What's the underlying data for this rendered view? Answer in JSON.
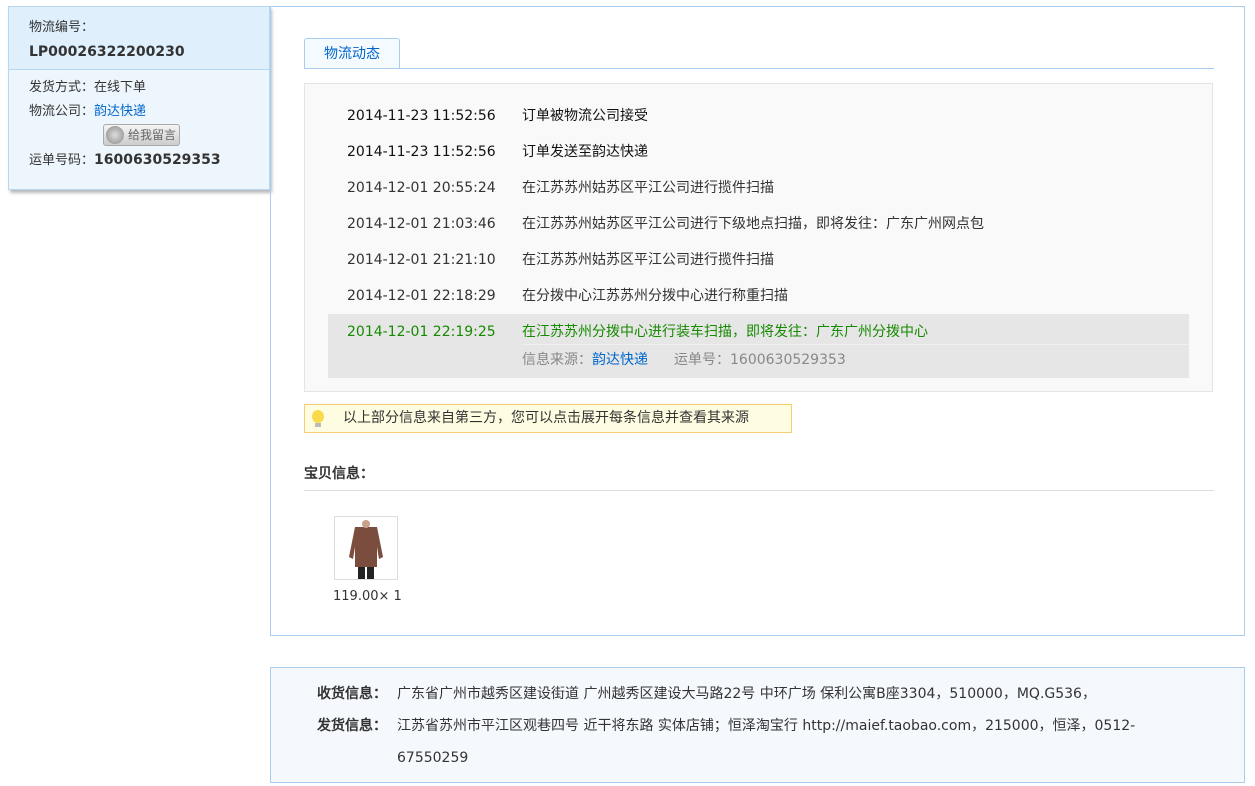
{
  "left": {
    "order_label": "物流编号：",
    "order_no": "LP00026322200230",
    "ship_method_label": "发货方式：",
    "ship_method": "在线下单",
    "company_label": "物流公司：",
    "company": "韵达快递",
    "message_button": "给我留言",
    "waybill_label": "运单号码：",
    "waybill_no": "1600630529353"
  },
  "tab": "物流动态",
  "events": [
    {
      "time": "2014-11-23 11:52:56",
      "desc": "订单被物流公司接受"
    },
    {
      "time": "2014-11-23 11:52:56",
      "desc": "订单发送至韵达快递"
    },
    {
      "time": "2014-12-01 20:55:24",
      "desc": "在江苏苏州姑苏区平江公司进行揽件扫描"
    },
    {
      "time": "2014-12-01 21:03:46",
      "desc": "在江苏苏州姑苏区平江公司进行下级地点扫描，即将发往：广东广州网点包"
    },
    {
      "time": "2014-12-01 21:21:10",
      "desc": "在江苏苏州姑苏区平江公司进行揽件扫描"
    },
    {
      "time": "2014-12-01 22:18:29",
      "desc": "在分拨中心江苏苏州分拨中心进行称重扫描"
    },
    {
      "time": "2014-12-01 22:19:25",
      "desc": "在江苏苏州分拨中心进行装车扫描，即将发往：广东广州分拨中心"
    }
  ],
  "latest_source": {
    "source_label": "信息来源：",
    "source": "韵达快递",
    "waybill_label": "运单号：",
    "waybill": "1600630529353"
  },
  "tip": "以上部分信息来自第三方，您可以点击展开每条信息并查看其来源",
  "items_title": "宝贝信息：",
  "item": {
    "price_qty": "119.00× 1"
  },
  "address": {
    "recv_label": "收货信息：",
    "recv": "广东省广州市越秀区建设街道 广州越秀区建设大马路22号 中环广场 保利公寓B座3304，510000，MQ.G536，",
    "send_label": "发货信息：",
    "send": "江苏省苏州市平江区观巷四号 近干将东路 实体店铺；恒泽淘宝行 http://maief.taobao.com，215000，恒泽，0512-67550259"
  }
}
